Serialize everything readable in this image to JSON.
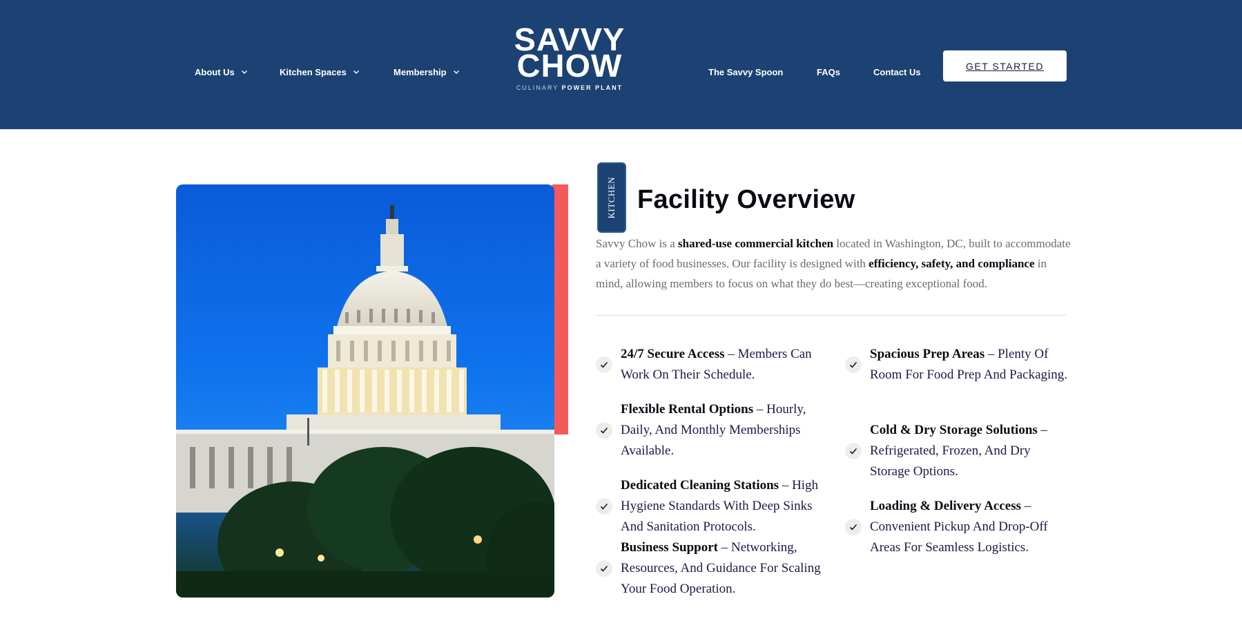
{
  "header": {
    "nav_left": [
      {
        "label": "About Us"
      },
      {
        "label": "Kitchen Spaces"
      },
      {
        "label": "Membership"
      }
    ],
    "logo": {
      "line1": "SAVVY",
      "line2": "CHOW",
      "tag_light": "CULINARY",
      "tag_bold": "POWER PLANT"
    },
    "nav_right": [
      {
        "label": "The Savvy Spoon"
      },
      {
        "label": "FAQs"
      },
      {
        "label": "Contact Us"
      }
    ],
    "cta_label": "GET STARTED",
    "colors": {
      "header_bg": "#1b4272",
      "accent": "#f45a5c"
    }
  },
  "main": {
    "badge": "KITCHEN",
    "title": "Facility Overview",
    "intro": {
      "p1": "Savvy Chow is a ",
      "b1": "shared-use commercial kitchen",
      "p2": " located in Washington, DC, built to accommodate a variety of food businesses. Our facility is designed with ",
      "b2": "efficiency, safety, and compliance",
      "p3": " in mind, allowing members to focus on what they do best—creating exceptional food."
    },
    "features_left": [
      {
        "bold": "24/7 Secure Access",
        "rest": " – Members Can Work On Their Schedule."
      },
      {
        "bold": "Flexible Rental Options",
        "rest": " – Hourly, Daily, And Monthly Memberships Available."
      },
      {
        "bold": "Dedicated Cleaning Stations",
        "rest": " – High Hygiene Standards With Deep Sinks And Sanitation Protocols."
      },
      {
        "bold": "Business Support",
        "rest": " – Networking, Resources, And Guidance For Scaling Your Food Operation."
      }
    ],
    "features_right": [
      {
        "bold": "Spacious Prep Areas",
        "rest": " – Plenty Of Room For Food Prep And Packaging."
      },
      {
        "bold": "Cold & Dry Storage Solutions",
        "rest": " – Refrigerated, Frozen, And Dry Storage Options."
      },
      {
        "bold": "Loading & Delivery Access",
        "rest": " – Convenient Pickup And Drop-Off Areas For Seamless Logistics."
      }
    ],
    "check_icon": "check-icon"
  }
}
